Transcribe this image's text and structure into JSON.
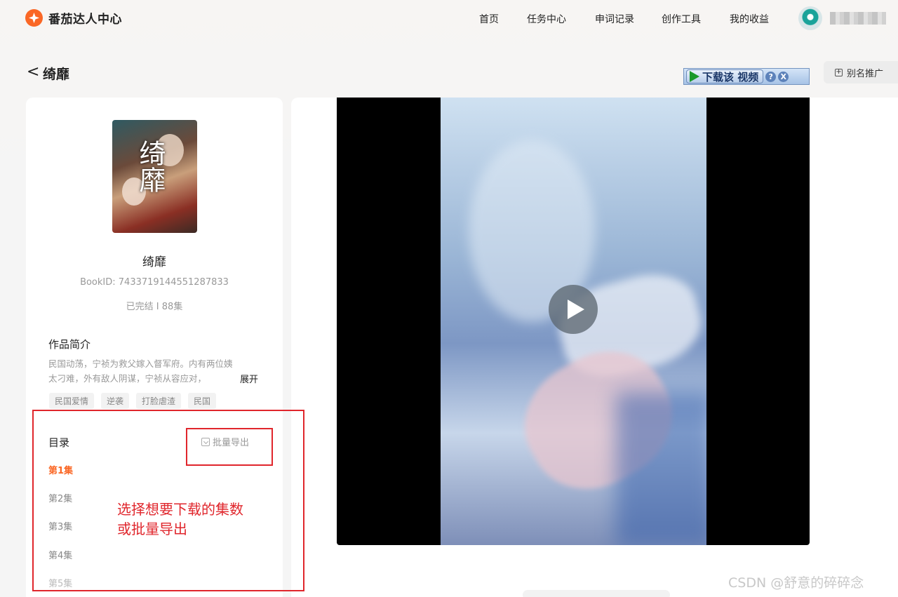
{
  "header": {
    "app_name": "番茄达人中心",
    "nav": [
      "首页",
      "任务中心",
      "申词记录",
      "创作工具",
      "我的收益"
    ]
  },
  "title_row": {
    "back_glyph": "<",
    "title": "绮靡",
    "download_toolbar": {
      "label": "下载该 视频",
      "help": "?",
      "close": "X"
    },
    "alias_button": "别名推广"
  },
  "book": {
    "cover_text": "绮靡",
    "name": "绮靡",
    "book_id": "BookID: 7433719144551287833",
    "status": "已完结 I 88集",
    "intro_title": "作品简介",
    "intro": "民国动荡，宁祯为救父嫁入督军府。内有两位姨太刁难，外有敌人阴谋，宁祯从容应对，",
    "expand_label": "展开",
    "tags": [
      "民国爱情",
      "逆袭",
      "打脸虐渣",
      "民国"
    ]
  },
  "toc": {
    "title": "目录",
    "export_label": "批量导出",
    "episodes": [
      "第1集",
      "第2集",
      "第3集",
      "第4集",
      "第5集"
    ],
    "active_index": 0
  },
  "annotation": {
    "line1": "选择想要下载的集数",
    "line2": "或批量导出",
    "color": "#e0262c"
  },
  "watermark": "CSDN @舒意的碎碎念",
  "colors": {
    "accent": "#fa6725",
    "annotation": "#e0262c"
  }
}
